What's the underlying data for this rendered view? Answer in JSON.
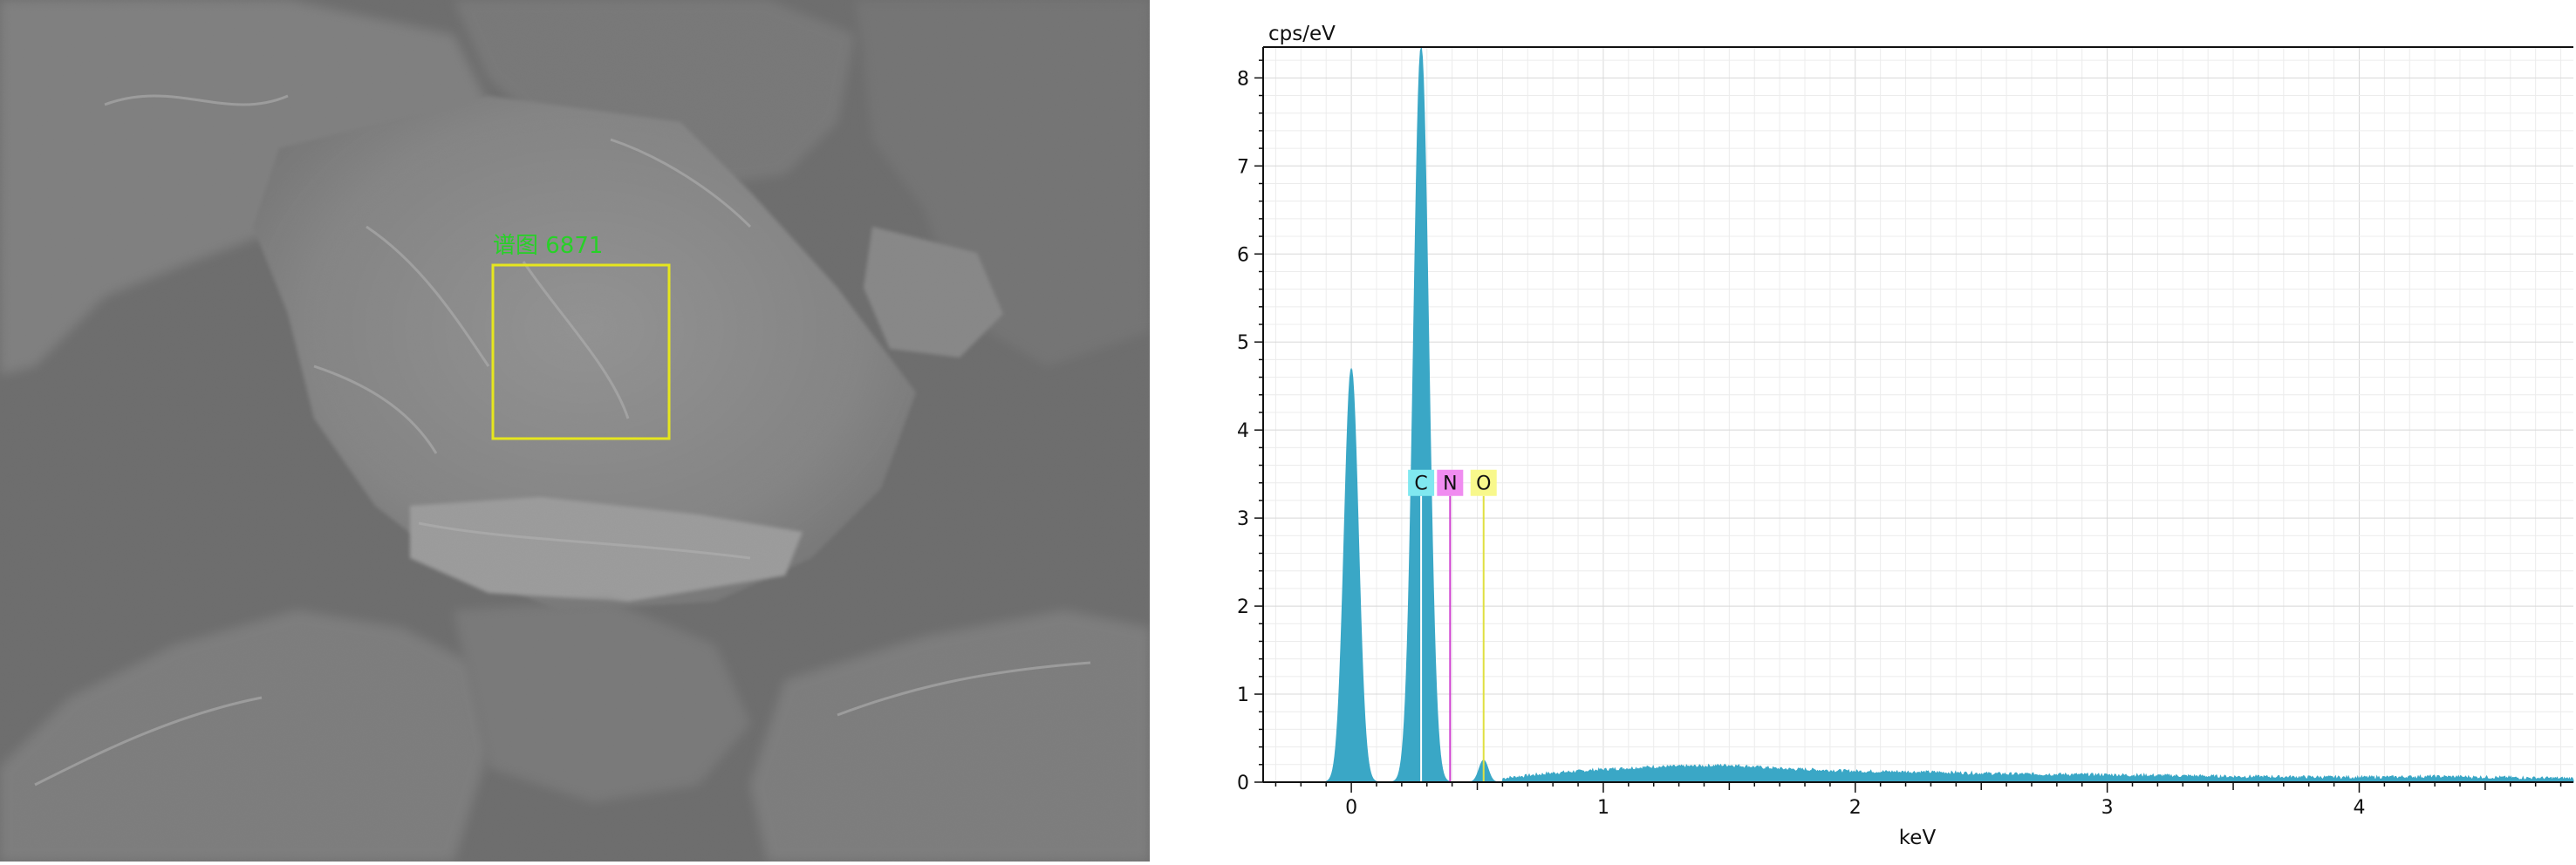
{
  "sem_image": {
    "region_label": "谱图 6871",
    "marker_color": "#e6e61e",
    "label_color": "#27d127"
  },
  "chart_data": {
    "type": "area",
    "title": "",
    "ylabel": "cps/eV",
    "xlabel": "keV",
    "xlim": [
      -0.35,
      4.85
    ],
    "ylim": [
      0,
      8.35
    ],
    "xticks": [
      0,
      1,
      2,
      3,
      4
    ],
    "yticks": [
      0,
      1,
      2,
      3,
      4,
      5,
      6,
      7,
      8
    ],
    "grid": true,
    "series_color": "#3aa7c6",
    "peaks": [
      {
        "x": 0.0,
        "y": 4.7
      },
      {
        "x": 0.277,
        "y": 8.35
      },
      {
        "x": 0.525,
        "y": 0.25
      }
    ],
    "continuum": {
      "x": [
        0.6,
        0.8,
        1.0,
        1.2,
        1.4,
        1.5,
        1.7,
        2.0,
        2.3,
        2.6,
        3.0,
        3.5,
        4.0,
        4.3,
        4.8
      ],
      "y": [
        0.04,
        0.1,
        0.14,
        0.17,
        0.18,
        0.19,
        0.15,
        0.12,
        0.11,
        0.09,
        0.08,
        0.06,
        0.05,
        0.06,
        0.04
      ]
    },
    "element_lines": [
      {
        "label": "C",
        "x": 0.277,
        "color": "#80e8f0",
        "line_color": "#ffffff"
      },
      {
        "label": "N",
        "x": 0.392,
        "color": "#f08cf0",
        "line_color": "#d040d0"
      },
      {
        "label": "O",
        "x": 0.525,
        "color": "#f8f88c",
        "line_color": "#e0e040"
      }
    ]
  }
}
